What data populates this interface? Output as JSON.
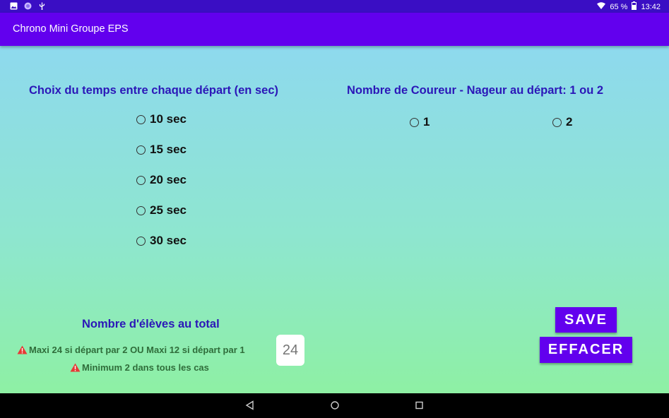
{
  "status_bar": {
    "battery": "65 %",
    "time": "13:42",
    "icons": [
      "image-icon",
      "circle-notification-icon",
      "usb-icon",
      "wifi-icon",
      "battery-icon"
    ]
  },
  "app_bar": {
    "title": "Chrono Mini Groupe EPS"
  },
  "interval_section": {
    "heading": "Choix du temps entre chaque départ (en sec)",
    "options": [
      "10 sec",
      "15 sec",
      "20 sec",
      "25 sec",
      "30 sec"
    ]
  },
  "runners_section": {
    "heading": "Nombre de Coureur - Nageur au départ: 1 ou 2",
    "options": [
      "1",
      "2"
    ]
  },
  "students_section": {
    "heading": "Nombre d'élèves au total",
    "warning_1": "Maxi 24 si départ par 2 OU Maxi 12 si départ par 1",
    "warning_2": "Minimum 2 dans tous les cas",
    "count_placeholder": "24"
  },
  "buttons": {
    "save": "SAVE",
    "clear": "EFFACER"
  },
  "colors": {
    "accent": "#6200ee",
    "status_bar": "#3a0ec4",
    "heading": "#2b17b8",
    "warning_text": "#2f6d3a",
    "warning_icon": "#e53935"
  },
  "nav_bar": {
    "icons": [
      "back-icon",
      "home-icon",
      "recents-icon"
    ]
  }
}
